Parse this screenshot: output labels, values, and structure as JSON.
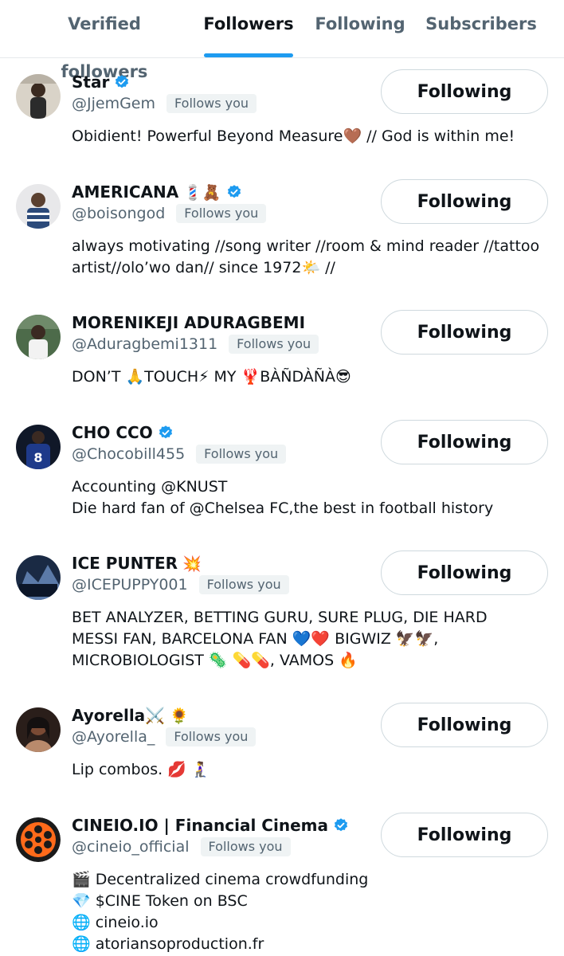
{
  "tabs": [
    {
      "label": "Verified followers"
    },
    {
      "label": "Followers"
    },
    {
      "label": "Following"
    },
    {
      "label": "Subscribers"
    }
  ],
  "active_tab": "Followers",
  "colors": {
    "accent": "#1d9bf0",
    "muted": "#536471",
    "badge_bg": "#eff3f4"
  },
  "follows_you_label": "Follows you",
  "users": [
    {
      "name": "Star",
      "emoji": "",
      "verified": true,
      "handle": "@JjemGem",
      "follows_you": "Follows you",
      "button": "Following",
      "bio": [
        "Obidient! Powerful Beyond Measure🤎 // God is within me!"
      ]
    },
    {
      "name": "AMERICANA",
      "emoji": "💈🧸",
      "verified": true,
      "handle": "@boisongod",
      "follows_you": "Follows you",
      "button": "Following",
      "bio": [
        "always motivating //song writer //room & mind reader //tattoo",
        "artist//olo’wo dan// since 1972🌤️ //"
      ]
    },
    {
      "name": "MORENIKEJI ADURAGBEMI",
      "emoji": "",
      "verified": false,
      "handle": "@Aduragbemi1311",
      "follows_you": "Follows you",
      "button": "Following",
      "bio": [
        "DON’T 🙏TOUCH⚡ MY 🦞BÀÑDÀÑÀ😎"
      ]
    },
    {
      "name": "CHO CCO",
      "emoji": "",
      "verified": true,
      "handle": "@Chocobill455",
      "follows_you": "Follows you",
      "button": "Following",
      "bio": [
        "Accounting @KNUST",
        "Die hard fan of @Chelsea FC,the best in football history"
      ]
    },
    {
      "name": "ICE PUNTER",
      "emoji": "💥",
      "verified": false,
      "handle": "@ICEPUPPY001",
      "follows_you": "Follows you",
      "button": "Following",
      "bio": [
        "BET ANALYZER, BETTING GURU, SURE PLUG, DIE HARD",
        "MESSI FAN, BARCELONA FAN 💙❤️ BIGWIZ 🦅🦅,",
        "MICROBIOLOGIST 🦠 💊💊, VAMOS 🔥"
      ]
    },
    {
      "name": "Ayorella⚔️",
      "emoji": "🌻",
      "verified": false,
      "handle": "@Ayorella_",
      "follows_you": "Follows you",
      "button": "Following",
      "bio": [
        "Lip combos. 💋 🧎‍♀️"
      ]
    },
    {
      "name": "CINEIO.IO | Financial Cinema",
      "emoji": "",
      "verified": true,
      "handle": "@cineio_official",
      "follows_you": "Follows you",
      "button": "Following",
      "bio": [
        "🎬 Decentralized cinema crowdfunding",
        "💎 $CINE Token on BSC",
        "🌐 cineio.io",
        "🌐 atoriansoproduction.fr"
      ]
    }
  ]
}
